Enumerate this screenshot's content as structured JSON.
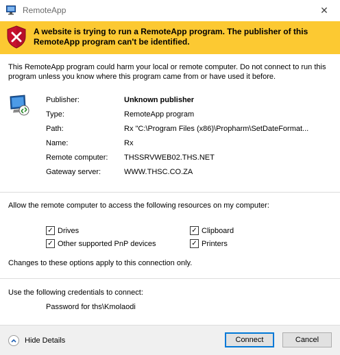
{
  "window": {
    "title": "RemoteApp",
    "close_glyph": "✕"
  },
  "warning": {
    "text": "A website is trying to run a RemoteApp program. The publisher of this RemoteApp program can't be identified.",
    "band_color": "#fcc932",
    "icon": "shield-error-icon"
  },
  "intro": "This RemoteApp program could harm your local or remote computer. Do not connect to run this program unless you know where this program came from or have used it before.",
  "details": [
    {
      "label": "Publisher:",
      "value": "Unknown publisher"
    },
    {
      "label": "Type:",
      "value": "RemoteApp program"
    },
    {
      "label": "Path:",
      "value": "Rx \"C:\\Program Files (x86)\\Propharm\\SetDateFormat..."
    },
    {
      "label": "Name:",
      "value": "Rx"
    },
    {
      "label": "Remote computer:",
      "value": "THSSRVWEB02.THS.NET"
    },
    {
      "label": "Gateway server:",
      "value": "WWW.THSC.CO.ZA"
    }
  ],
  "resources": {
    "caption": "Allow the remote computer to access the following resources on my computer:",
    "items": [
      {
        "label": "Drives",
        "checked": true
      },
      {
        "label": "Clipboard",
        "checked": true
      },
      {
        "label": "Other supported PnP devices",
        "checked": true
      },
      {
        "label": "Printers",
        "checked": true
      }
    ],
    "note": "Changes to these options apply to this connection only."
  },
  "credentials": {
    "caption": "Use the following credentials to connect:",
    "value": "Password for ths\\Kmolaodi"
  },
  "footer": {
    "hide_details": "Hide Details",
    "connect": "Connect",
    "cancel": "Cancel"
  },
  "check_glyph": "✓",
  "accent_color": "#0078d7"
}
